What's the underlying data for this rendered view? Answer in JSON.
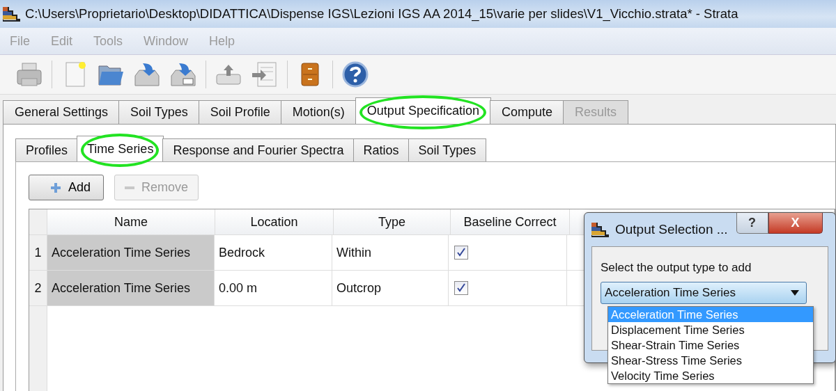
{
  "window": {
    "title": "C:\\Users\\Proprietario\\Desktop\\DIDATTICA\\Dispense IGS\\Lezioni IGS AA 2014_15\\varie per slides\\V1_Vicchio.strata* - Strata"
  },
  "menu": [
    {
      "label": "File"
    },
    {
      "label": "Edit"
    },
    {
      "label": "Tools"
    },
    {
      "label": "Window"
    },
    {
      "label": "Help"
    }
  ],
  "tabs": [
    {
      "label": "General Settings",
      "selected": false,
      "disabled": false,
      "circled": false
    },
    {
      "label": "Soil Types",
      "selected": false,
      "disabled": false,
      "circled": false
    },
    {
      "label": "Soil Profile",
      "selected": false,
      "disabled": false,
      "circled": false
    },
    {
      "label": "Motion(s)",
      "selected": false,
      "disabled": false,
      "circled": false
    },
    {
      "label": "Output Specification",
      "selected": true,
      "disabled": false,
      "circled": true
    },
    {
      "label": "Compute",
      "selected": false,
      "disabled": false,
      "circled": false
    },
    {
      "label": "Results",
      "selected": false,
      "disabled": true,
      "circled": false
    }
  ],
  "subtabs": [
    {
      "label": "Profiles",
      "selected": false,
      "circled": false
    },
    {
      "label": "Time Series",
      "selected": true,
      "circled": true
    },
    {
      "label": "Response and Fourier Spectra",
      "selected": false,
      "circled": false
    },
    {
      "label": "Ratios",
      "selected": false,
      "circled": false
    },
    {
      "label": "Soil Types",
      "selected": false,
      "circled": false
    }
  ],
  "buttons": [
    {
      "label": "Add",
      "kind": "add",
      "disabled": false
    },
    {
      "label": "Remove",
      "kind": "remove",
      "disabled": true
    }
  ],
  "table": {
    "columns": [
      "Name",
      "Location",
      "Type",
      "Baseline Correct"
    ],
    "rows": [
      {
        "number": "1",
        "name": "Acceleration Time Series",
        "location": "Bedrock",
        "type": "Within",
        "checked": true
      },
      {
        "number": "2",
        "name": "Acceleration Time Series",
        "location": "0.00 m",
        "type": "Outcrop",
        "checked": true
      }
    ]
  },
  "dialog": {
    "title": "Output Selection ...",
    "help": "?",
    "close": "X",
    "prompt": "Select the output type to add",
    "value": "Acceleration Time Series",
    "options": [
      {
        "label": "Acceleration Time Series",
        "selected": true
      },
      {
        "label": "Displacement Time Series",
        "selected": false
      },
      {
        "label": "Shear-Strain Time Series",
        "selected": false
      },
      {
        "label": "Shear-Stress Time Series",
        "selected": false
      },
      {
        "label": "Velocity Time Series",
        "selected": false
      }
    ]
  }
}
